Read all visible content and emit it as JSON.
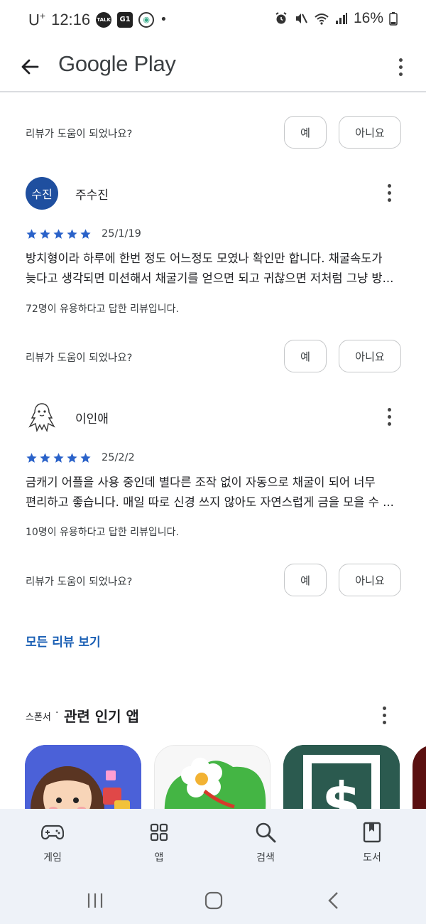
{
  "status_bar": {
    "carrier": "U",
    "carrier_sup": "+",
    "time": "12:16",
    "notif_icons": [
      "talk-icon",
      "g1-icon",
      "bird-icon"
    ],
    "battery_percent": "16%"
  },
  "app_bar": {
    "title": "Google Play"
  },
  "helpful_prompt": {
    "question": "리뷰가 도움이 되었나요?",
    "yes": "예",
    "no": "아니요"
  },
  "reviews": [
    {
      "avatar_text": "수진",
      "name": "주수진",
      "rating": 5,
      "date": "25/1/19",
      "text_lines": [
        "방치형이라 하루에 한번 정도 어느정도 모였나 확인만 합니다. 채굴속도가",
        "늦다고 생각되면 미션해서 채굴기를 얻으면 되고 귀찮으면 저처럼 그냥 방..."
      ],
      "helpful_count": "72명이 유용하다고 답한 리뷰입니다."
    },
    {
      "avatar_text": "",
      "name": "이인애",
      "rating": 5,
      "date": "25/2/2",
      "text_lines": [
        "금캐기 어플을 사용 중인데 별다른 조작 없이 자동으로 채굴이 되어 너무",
        "편리하고 좋습니다. 매일 따로 신경 쓰지 않아도 자연스럽게 금을 모을 수 ..."
      ],
      "helpful_count": "10명이 유용하다고 답한 리뷰입니다."
    }
  ],
  "all_reviews_link": "모든 리뷰 보기",
  "related_section": {
    "sponsor_label": "스폰서",
    "separator": "·",
    "title": "관련 인기 앱"
  },
  "bottom_nav": {
    "games": "게임",
    "apps": "앱",
    "search": "검색",
    "books": "도서"
  },
  "colors": {
    "accent_blue": "#1a5fb4",
    "star_blue": "#2a62c9",
    "avatar_blue": "#1f4f9f",
    "nav_bg": "#eef2f8"
  }
}
